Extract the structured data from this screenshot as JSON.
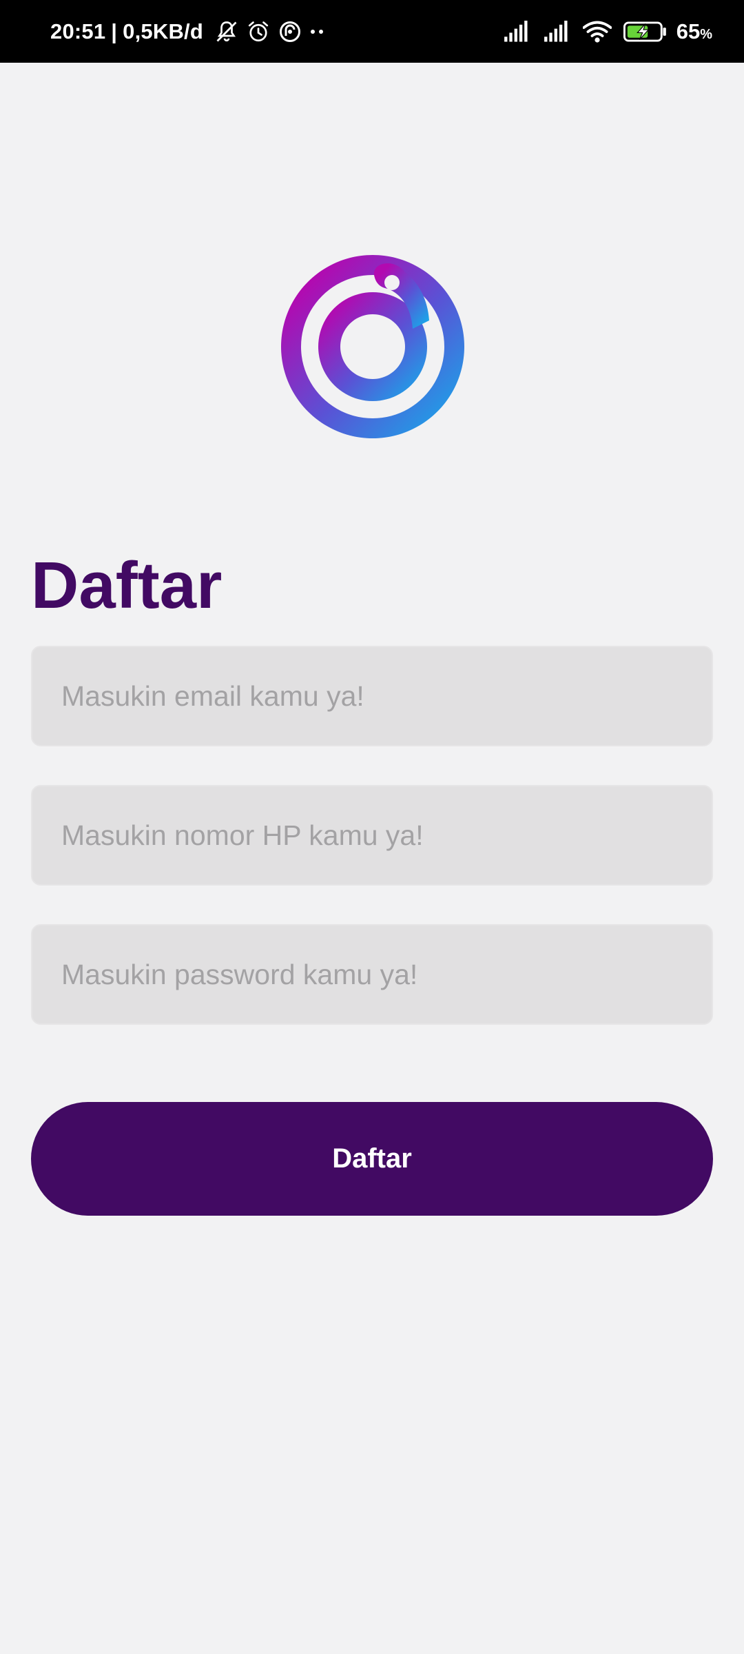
{
  "status_bar": {
    "time": "20:51",
    "separator": "|",
    "network_speed": "0,5KB/d",
    "left_icons": [
      "mute-icon",
      "alarm-icon",
      "vpn-icon",
      "more-dots-icon"
    ],
    "right_icons": [
      "signal-icon",
      "signal-icon",
      "wifi-icon",
      "battery-charging-icon"
    ],
    "battery_value": "65",
    "battery_unit": "%",
    "battery_level": 0.65
  },
  "logo": {
    "icon": "app-logo-spiral",
    "colors": [
      "#b20ab0",
      "#5a52d5",
      "#0fb4ec"
    ]
  },
  "form": {
    "title": "Daftar",
    "email_placeholder": "Masukin email kamu ya!",
    "phone_placeholder": "Masukin nomor HP kamu ya!",
    "password_placeholder": "Masukin password kamu ya!",
    "submit_label": "Daftar"
  },
  "theme": {
    "primary": "#420a63",
    "background": "#f2f2f3",
    "field_background": "#e1e0e1",
    "placeholder": "#a3a2a4"
  }
}
